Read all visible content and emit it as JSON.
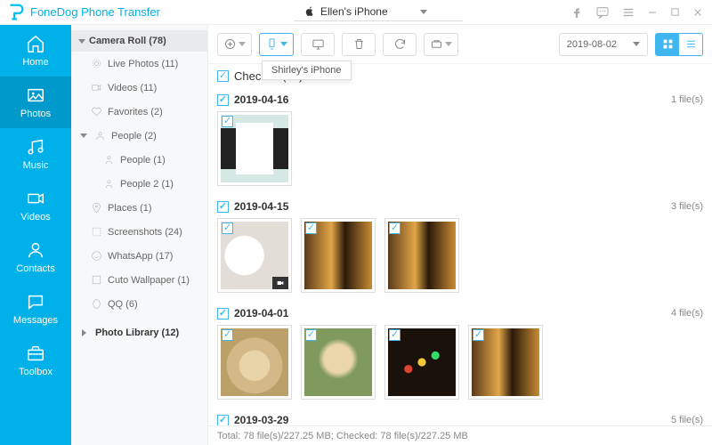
{
  "app": {
    "name": "FoneDog Phone Transfer"
  },
  "device": {
    "name": "Ellen's iPhone"
  },
  "tooltip": "Shirley's iPhone",
  "nav": [
    {
      "key": "home",
      "label": "Home"
    },
    {
      "key": "photos",
      "label": "Photos"
    },
    {
      "key": "music",
      "label": "Music"
    },
    {
      "key": "videos",
      "label": "Videos"
    },
    {
      "key": "contacts",
      "label": "Contacts"
    },
    {
      "key": "messages",
      "label": "Messages"
    },
    {
      "key": "toolbox",
      "label": "Toolbox"
    }
  ],
  "sidebar": {
    "group1": "Camera Roll (78)",
    "items": [
      "Live Photos (11)",
      "Videos (11)",
      "Favorites (2)",
      "People (2)",
      "People (1)",
      "People 2 (1)",
      "Places (1)",
      "Screenshots (24)",
      "WhatsApp (17)",
      "Cuto Wallpaper (1)",
      "QQ (6)"
    ],
    "group2": "Photo Library (12)"
  },
  "toolbar": {
    "date": "2019-08-02"
  },
  "checkall": "Check All(78)",
  "groups": [
    {
      "date": "2019-04-16",
      "count": "1 file(s)"
    },
    {
      "date": "2019-04-15",
      "count": "3 file(s)"
    },
    {
      "date": "2019-04-01",
      "count": "4 file(s)"
    },
    {
      "date": "2019-03-29",
      "count": "5 file(s)"
    }
  ],
  "footer": "Total: 78 file(s)/227.25 MB; Checked: 78 file(s)/227.25 MB"
}
